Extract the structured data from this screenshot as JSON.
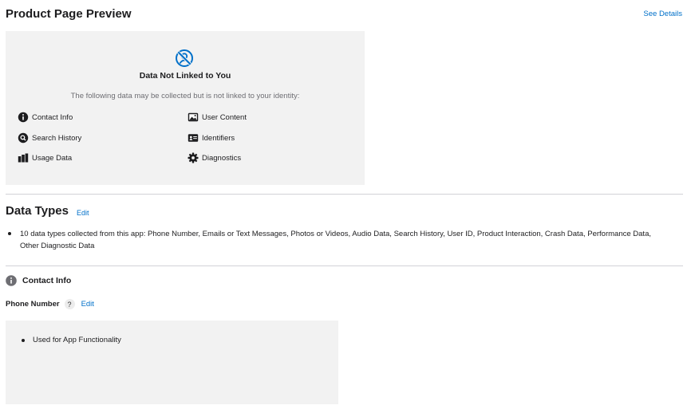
{
  "preview": {
    "title": "Product Page Preview",
    "see_details": "See Details",
    "card_icon": "not-linked-icon",
    "card_heading": "Data Not Linked to You",
    "card_subtext": "The following data may be collected but is not linked to your identity:",
    "categories": [
      {
        "label": "Contact Info",
        "icon": "info-icon"
      },
      {
        "label": "User Content",
        "icon": "photo-icon"
      },
      {
        "label": "Search History",
        "icon": "search-icon"
      },
      {
        "label": "Identifiers",
        "icon": "id-card-icon"
      },
      {
        "label": "Usage Data",
        "icon": "bar-chart-icon"
      },
      {
        "label": "Diagnostics",
        "icon": "gear-icon"
      }
    ]
  },
  "data_types": {
    "title": "Data Types",
    "edit_label": "Edit",
    "summary": "10 data types collected from this app: Phone Number, Emails or Text Messages, Photos or Videos, Audio Data, Search History, User ID, Product Interaction, Crash Data, Performance Data, Other Diagnostic Data"
  },
  "contact_info": {
    "heading": "Contact Info",
    "phone_label": "Phone Number",
    "help_label": "?",
    "edit_label": "Edit",
    "purposes": [
      "Used for App Functionality"
    ]
  },
  "colors": {
    "accent": "#0070c9",
    "panel_bg": "#f2f2f2",
    "divider": "#d2d2d7"
  }
}
